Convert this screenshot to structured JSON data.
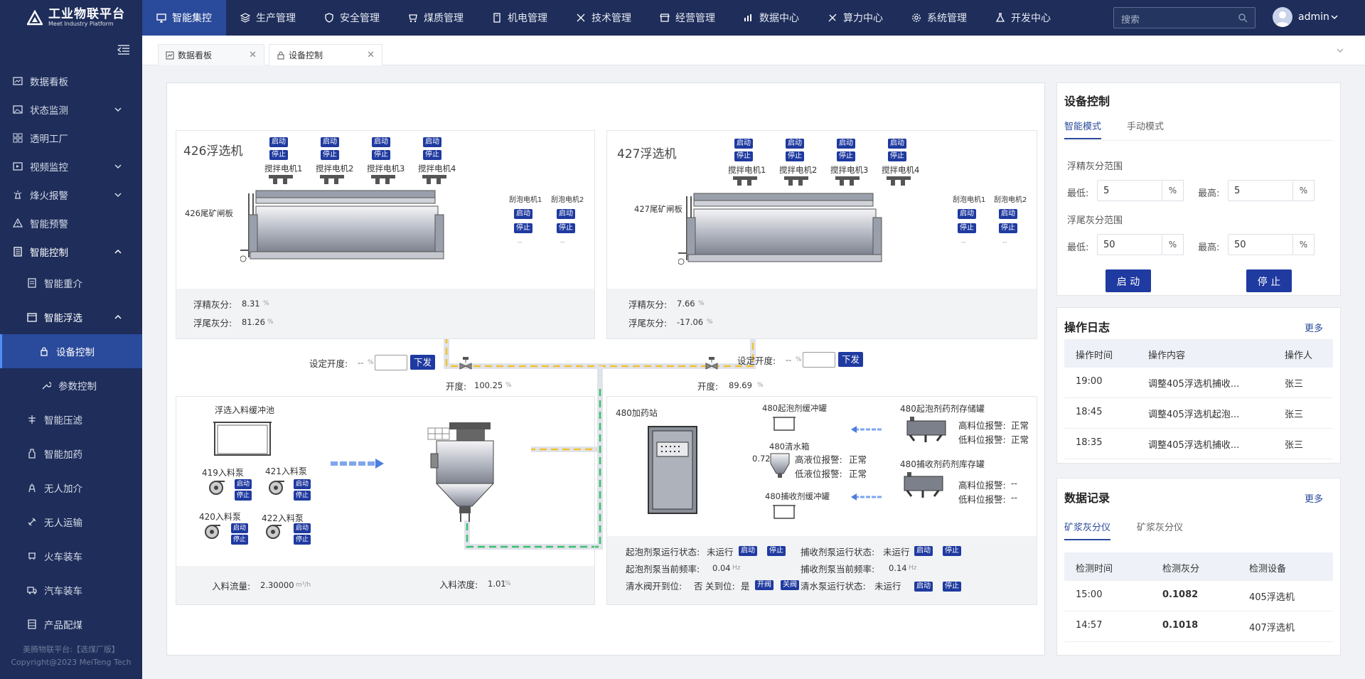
{
  "brand": {
    "name": "工业物联平台",
    "sub": "Meet Industry Platform"
  },
  "nav": [
    "智能集控",
    "生产管理",
    "安全管理",
    "煤质管理",
    "机电管理",
    "技术管理",
    "经营管理",
    "数据中心",
    "算力中心",
    "系统管理",
    "开发中心"
  ],
  "search": {
    "placeholder": "搜索"
  },
  "user": {
    "name": "admin"
  },
  "sidebar": {
    "items": [
      "数据看板",
      "状态监测",
      "透明工厂",
      "视频监控",
      "烽火报警",
      "智能预警",
      "智能控制",
      "智能重介",
      "智能浮选",
      "设备控制",
      "参数控制",
      "智能压滤",
      "智能加药",
      "无人加介",
      "无人运输",
      "火车装车",
      "汽车装车",
      "产品配煤"
    ],
    "footer1": "美腾物联平台:【选煤厂版】",
    "footer2": "Copyright@2023 MeiTeng Tech"
  },
  "tabs": [
    "数据看板",
    "设备控制"
  ],
  "m426": {
    "title": "426浮选机",
    "gate": "426尾矿闸板",
    "motors": [
      "搅拌电机1",
      "搅拌电机2",
      "搅拌电机3",
      "搅拌电机4"
    ],
    "scrapers": [
      "刮泡电机1",
      "刮泡电机2"
    ],
    "dash": "--",
    "conc_label": "浮精灰分:",
    "conc": "8.31",
    "tail_label": "浮尾灰分:",
    "tail": "81.26",
    "pct": "%"
  },
  "m427": {
    "title": "427浮选机",
    "gate": "427尾矿闸板",
    "motors": [
      "搅拌电机1",
      "搅拌电机2",
      "搅拌电机3",
      "搅拌电机4"
    ],
    "scrapers": [
      "刮泡电机1",
      "刮泡电机2"
    ],
    "dash": "--",
    "conc_label": "浮精灰分:",
    "conc": "7.66",
    "tail_label": "浮尾灰分:",
    "tail": "-17.06",
    "pct": "%"
  },
  "common": {
    "start": "启动",
    "stop": "停止",
    "issue": "下发",
    "open": "开阀",
    "close": "关阀"
  },
  "valve1": {
    "set_label": "设定开度:",
    "set_val": "--",
    "open_label": "开度:",
    "open_val": "100.25",
    "pct": "%"
  },
  "valve2": {
    "set_label": "设定开度:",
    "set_val": "--",
    "open_label": "开度:",
    "open_val": "89.69",
    "pct": "%"
  },
  "feed": {
    "tank": "浮选入料缓冲池",
    "pumps": [
      "419入料泵",
      "421入料泵",
      "420入料泵",
      "422入料泵"
    ],
    "flow_label": "入料流量:",
    "flow": "2.30000",
    "flow_unit": "m³/h",
    "dens_label": "入料浓度:",
    "dens": "1.01",
    "dens_unit": "%"
  },
  "dosing": {
    "station": "480加药站",
    "foam_tank": "480起泡剂缓冲罐",
    "water_tank": "480清水箱",
    "water_level": "0.72",
    "hi_label": "高液位报警:",
    "hi": "正常",
    "lo_label": "低液位报警:",
    "lo": "正常",
    "collector_tank": "480捕收剂缓冲罐",
    "foam_store": "480起泡剂药剂存储罐",
    "foam_hi_label": "高料位报警:",
    "foam_hi": "正常",
    "foam_lo_label": "低料位报警:",
    "foam_lo": "正常",
    "col_store": "480捕收剂药剂库存罐",
    "col_hi_label": "高料位报警:",
    "col_hi": "--",
    "col_lo_label": "低料位报警:",
    "col_lo": "--",
    "r1a": "起泡剂泵运行状态:",
    "r1a_v": "未运行",
    "r1b": "捕收剂泵运行状态:",
    "r1b_v": "未运行",
    "r2a": "起泡剂泵当前频率:",
    "r2a_v": "0.04",
    "r2a_u": "Hz",
    "r2b": "捕收剂泵当前频率:",
    "r2b_v": "0.14",
    "r2b_u": "Hz",
    "r3a": "清水阀开到位:",
    "r3a_v": "否",
    "r3b": "关到位:",
    "r3b_v": "是",
    "r3c": "清水泵运行状态:",
    "r3c_v": "未运行"
  },
  "control": {
    "title": "设备控制",
    "tabs": [
      "智能模式",
      "手动模式"
    ],
    "conc_range": "浮精灰分范围",
    "tail_range": "浮尾灰分范围",
    "low": "最低:",
    "high": "最高:",
    "conc_low": "5",
    "conc_high": "5",
    "tail_low": "50",
    "tail_high": "50",
    "pct": "%",
    "start": "启 动",
    "stop": "停 止"
  },
  "log": {
    "title": "操作日志",
    "more": "更多",
    "headers": [
      "操作时间",
      "操作内容",
      "操作人"
    ],
    "rows": [
      [
        "19:00",
        "调整405浮选机捕收...",
        "张三"
      ],
      [
        "18:45",
        "调整405浮选机起泡...",
        "张三"
      ],
      [
        "18:35",
        "调整405浮选机捕收...",
        "张三"
      ]
    ]
  },
  "records": {
    "title": "数据记录",
    "more": "更多",
    "tabs": [
      "矿浆灰分仪",
      "矿浆灰分仪"
    ],
    "headers": [
      "检测时间",
      "检测灰分",
      "检测设备"
    ],
    "rows": [
      [
        "15:00",
        "0.1082",
        "405浮选机"
      ],
      [
        "14:57",
        "0.1018",
        "407浮选机"
      ]
    ]
  },
  "colors": {
    "navy": "#1e2d5a",
    "accent": "#2a4a9b",
    "button": "#1f3aa0",
    "pipe_yellow": "#f1c232",
    "pipe_green": "#3cbf6e"
  }
}
